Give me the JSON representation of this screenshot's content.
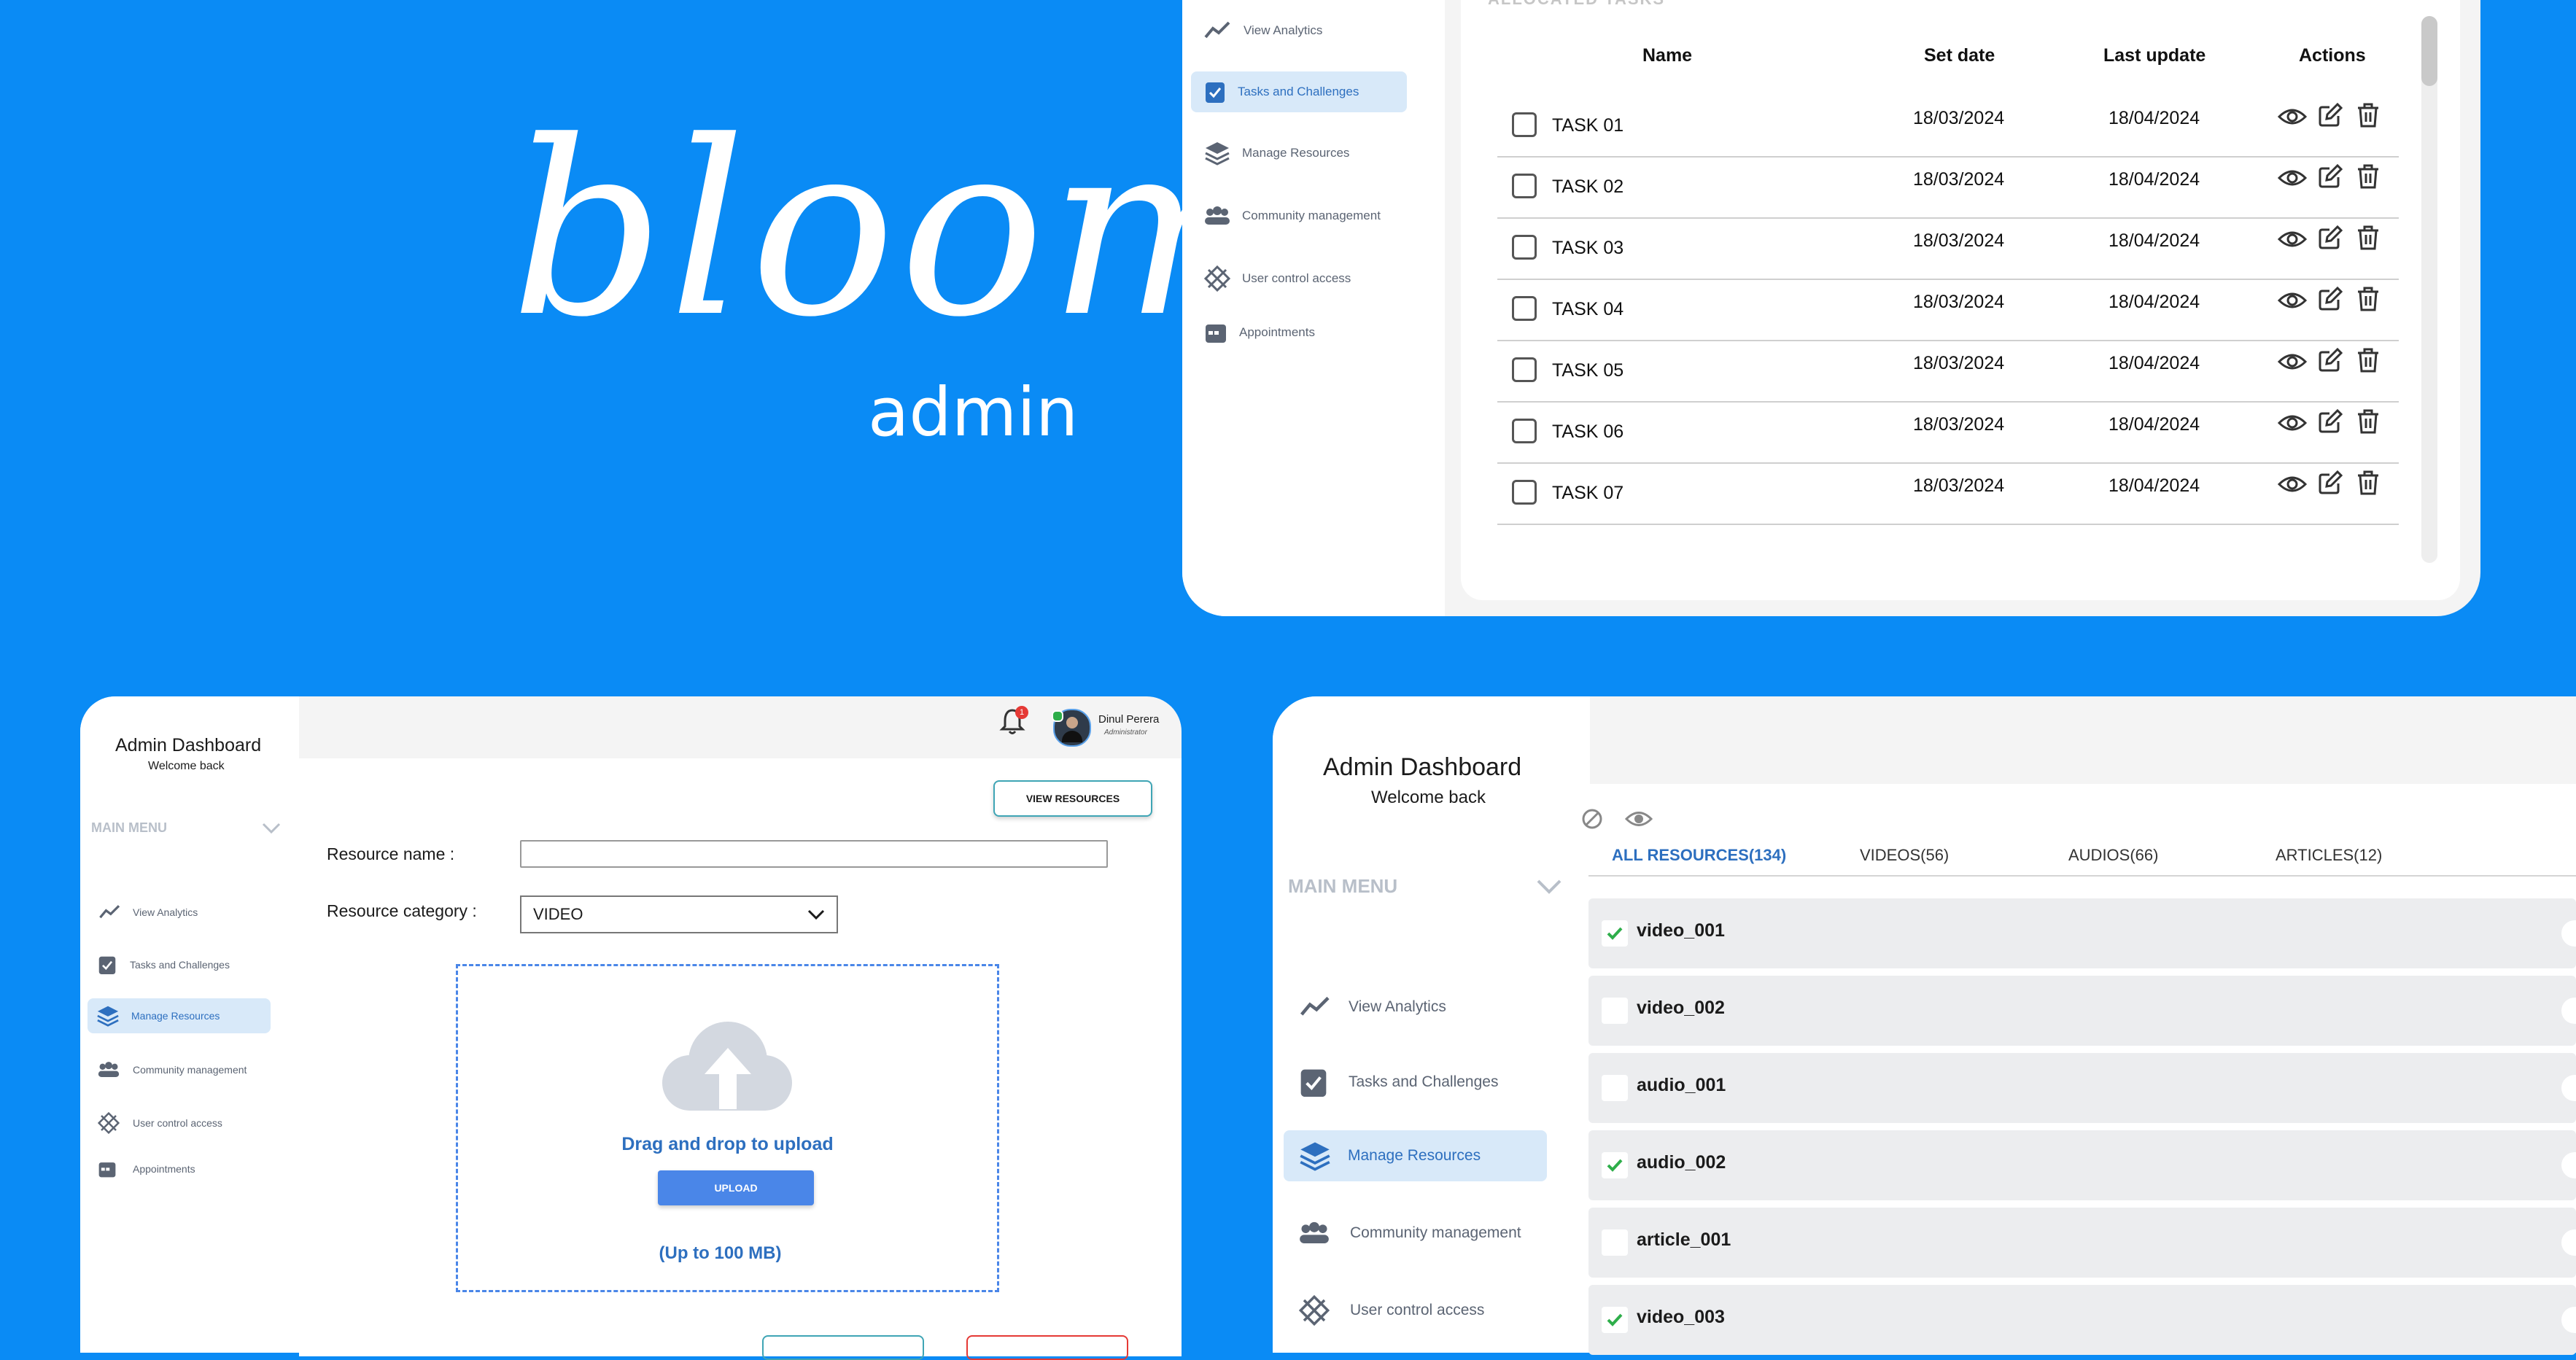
{
  "brand": {
    "logo_word": "bloom",
    "sub": "admin"
  },
  "colors": {
    "background": "#0A8BF5",
    "accent": "#4A86E8",
    "active_bg": "#D8E9F9",
    "check": "#2EAE4A"
  },
  "menu": {
    "analytics": "View Analytics",
    "tasks": "Tasks and Challenges",
    "resources": "Manage Resources",
    "community": "Community management",
    "access": "User control access",
    "appointments": "Appointments"
  },
  "tasks_panel": {
    "section_title": "ALLOCATED TASKS",
    "headers": {
      "name": "Name",
      "set_date": "Set date",
      "last_update": "Last update",
      "actions": "Actions"
    },
    "rows": [
      {
        "name": "TASK 01",
        "set_date": "18/03/2024",
        "last_update": "18/04/2024"
      },
      {
        "name": "TASK 02",
        "set_date": "18/03/2024",
        "last_update": "18/04/2024"
      },
      {
        "name": "TASK 03",
        "set_date": "18/03/2024",
        "last_update": "18/04/2024"
      },
      {
        "name": "TASK 04",
        "set_date": "18/03/2024",
        "last_update": "18/04/2024"
      },
      {
        "name": "TASK 05",
        "set_date": "18/03/2024",
        "last_update": "18/04/2024"
      },
      {
        "name": "TASK 06",
        "set_date": "18/03/2024",
        "last_update": "18/04/2024"
      },
      {
        "name": "TASK 07",
        "set_date": "18/03/2024",
        "last_update": "18/04/2024"
      }
    ]
  },
  "upload_panel": {
    "title": "Admin Dashboard",
    "subtitle": "Welcome back",
    "main_menu": "MAIN MENU",
    "notification_count": "1",
    "user_name": "Dinul Perera",
    "user_role": "Administrator",
    "view_resources": "VIEW RESOURCES",
    "resource_name_label": "Resource name :",
    "resource_name_value": "",
    "category_label": "Resource category :",
    "category_value": "VIDEO",
    "drop_text": "Drag and drop to upload",
    "upload_button": "UPLOAD",
    "limit_text": "(Up to 100 MB)"
  },
  "resources_panel": {
    "title": "Admin Dashboard",
    "subtitle": "Welcome back",
    "main_menu": "MAIN MENU",
    "tabs": [
      {
        "label": "ALL RESOURCES(134)",
        "active": true
      },
      {
        "label": "VIDEOS(56)",
        "active": false
      },
      {
        "label": "AUDIOS(66)",
        "active": false
      },
      {
        "label": "ARTICLES(12)",
        "active": false
      }
    ],
    "items": [
      {
        "name": "video_001",
        "checked": true
      },
      {
        "name": "video_002",
        "checked": false
      },
      {
        "name": "audio_001",
        "checked": false
      },
      {
        "name": "audio_002",
        "checked": true
      },
      {
        "name": "article_001",
        "checked": false
      },
      {
        "name": "video_003",
        "checked": true
      }
    ]
  }
}
